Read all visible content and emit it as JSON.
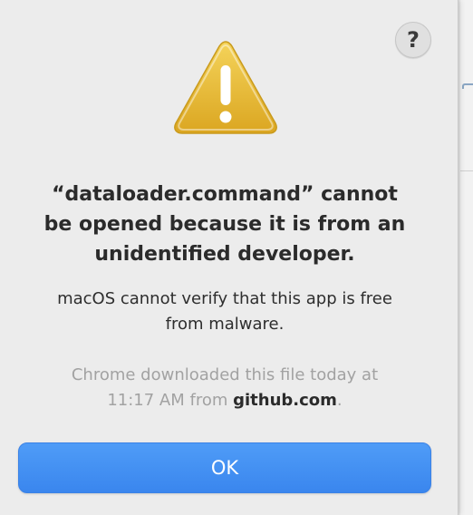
{
  "dialog": {
    "help_label": "?",
    "title_lines": [
      "“dataloader.command” cannot",
      "be opened because it is from an",
      "unidentified developer."
    ],
    "message_lines": [
      "macOS cannot verify that this app is free",
      "from malware."
    ],
    "info": {
      "line1": "Chrome downloaded this file today at",
      "line2_prefix": "11:17 AM from ",
      "domain": "github.com",
      "line2_suffix": "."
    },
    "ok_label": "OK"
  },
  "colors": {
    "accent_button": "#3a86ee",
    "warning_yellow": "#e8b930",
    "dialog_bg": "#ececec"
  },
  "icons": {
    "warning": "warning-triangle-icon",
    "help": "question-mark-icon"
  }
}
